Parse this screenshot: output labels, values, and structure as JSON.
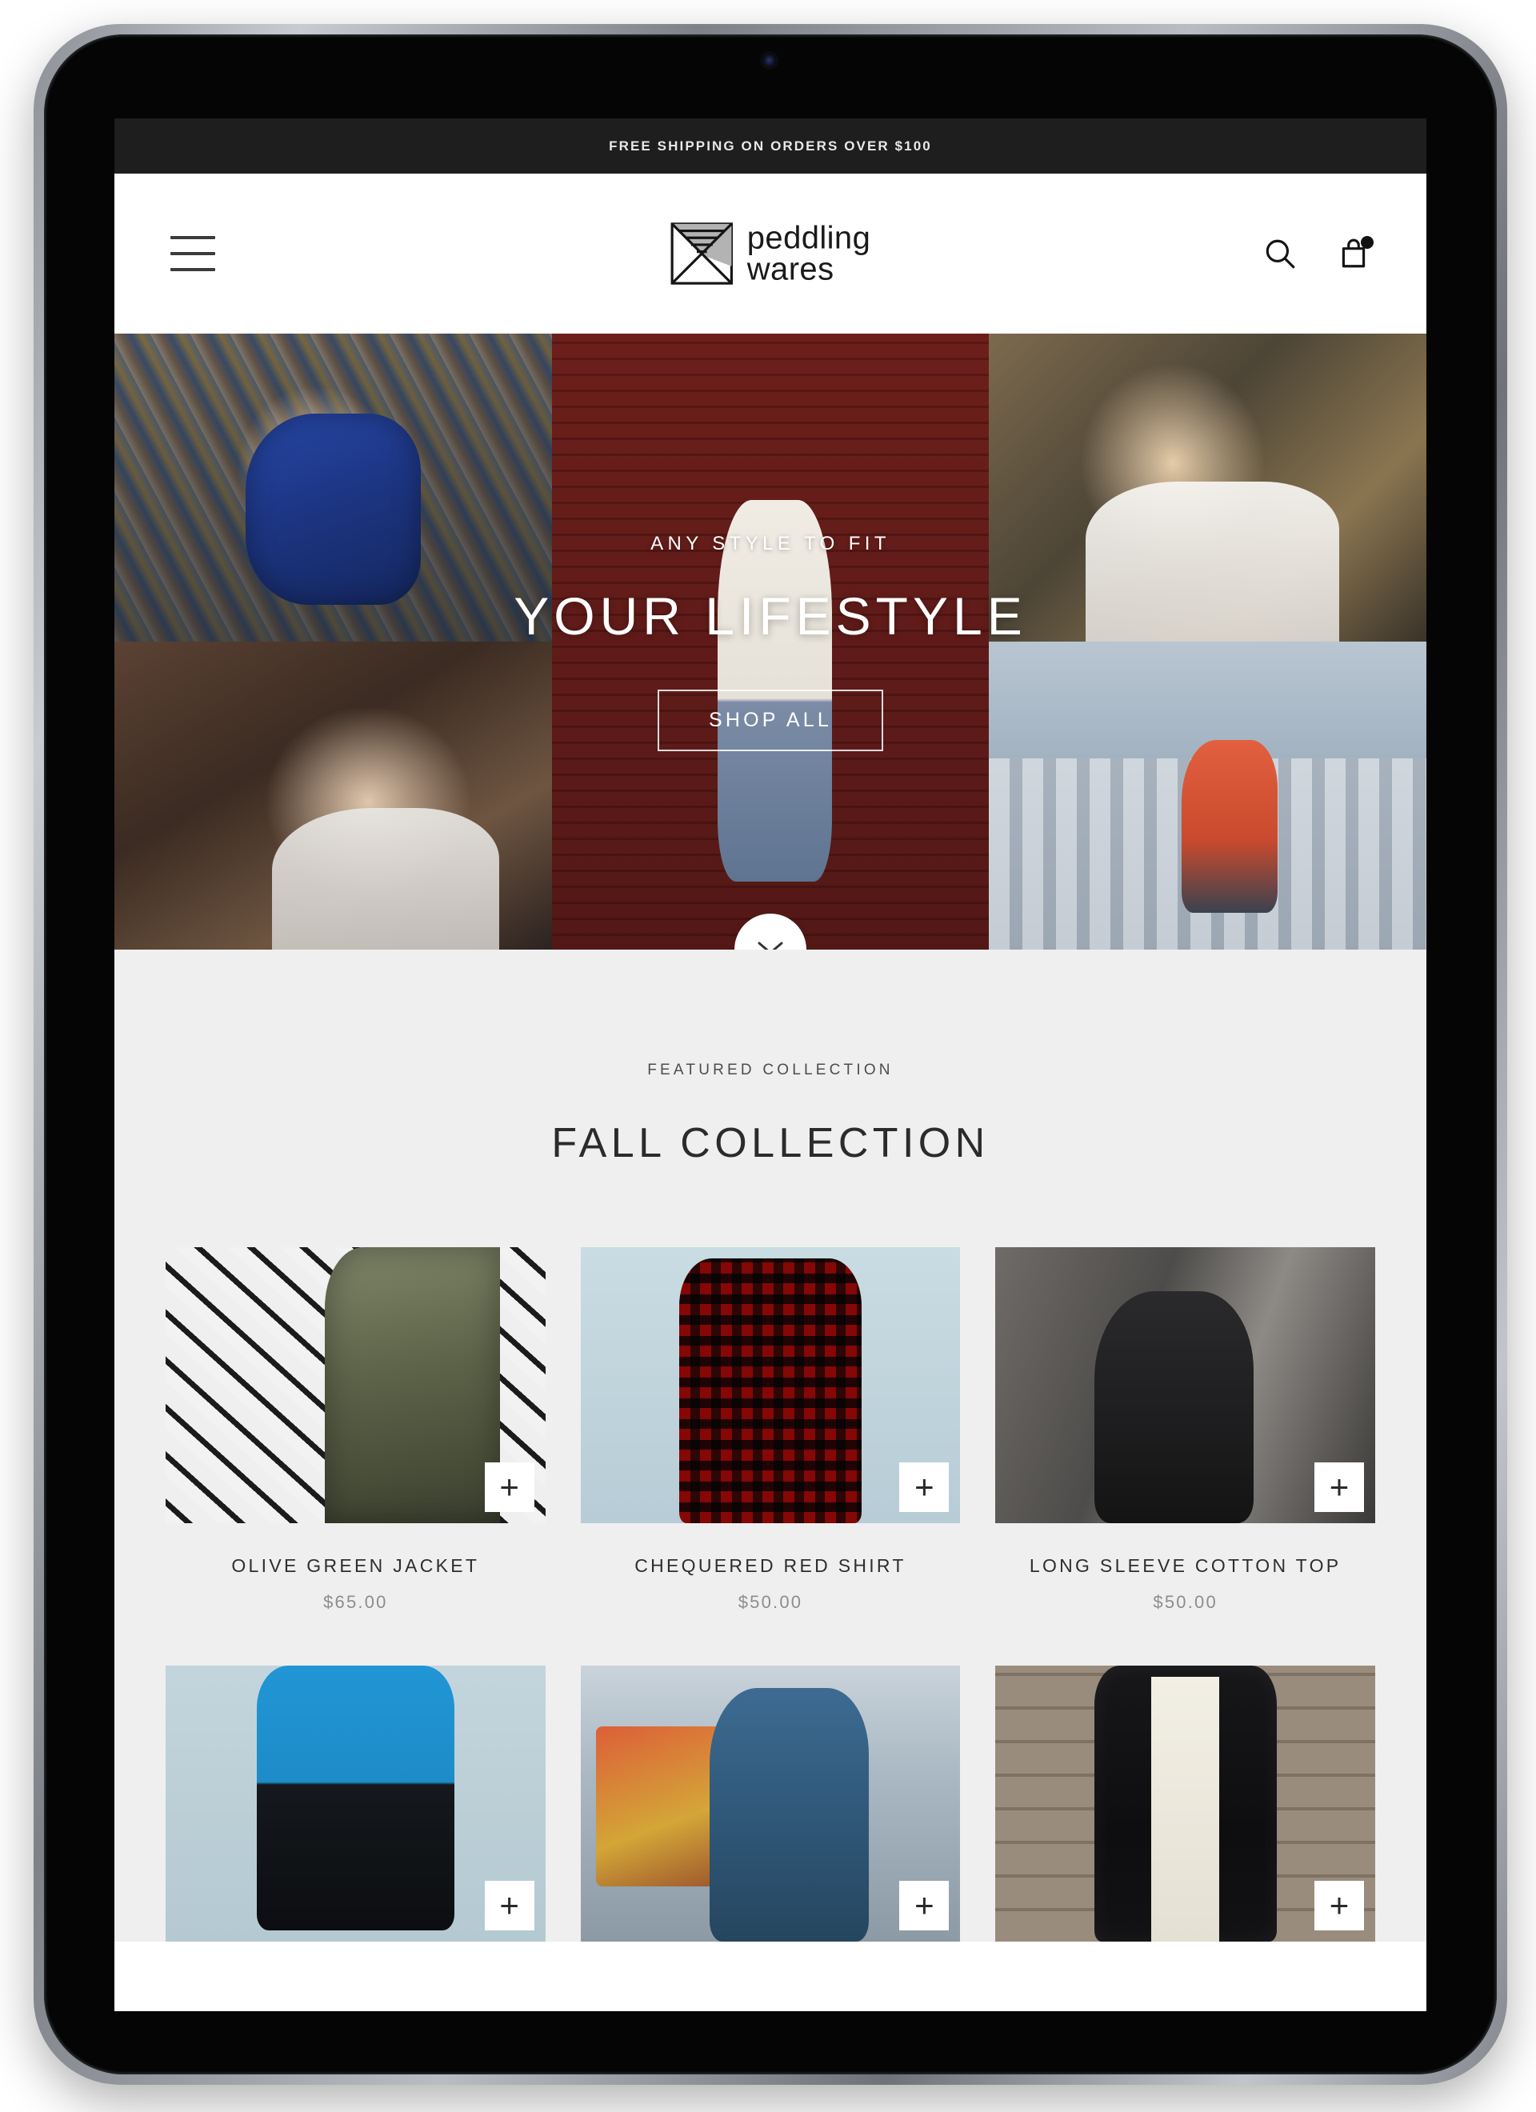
{
  "announcement": {
    "text": "FREE SHIPPING ON ORDERS OVER $100",
    "background": "#1e1e1e",
    "color": "#e8e8e8"
  },
  "header": {
    "menu_icon": "hamburger-menu-icon",
    "brand": {
      "mark_icon": "peddling-wares-logo-mark",
      "line1": "peddling",
      "line2": "wares"
    },
    "actions": [
      {
        "name": "search",
        "icon": "search-icon",
        "label": "Search"
      },
      {
        "name": "cart",
        "icon": "shopping-bag-icon",
        "label": "Cart",
        "badge": true
      }
    ]
  },
  "hero": {
    "eyebrow": "ANY STYLE TO FIT",
    "title": "YOUR LIFESTYLE",
    "cta_label": "SHOP ALL",
    "scroll_icon": "chevron-down-icon",
    "tiles": [
      {
        "name": "blonde-woman-at-fairground",
        "style": "ph-fair-blonde"
      },
      {
        "name": "couple-embracing-sunset",
        "style": "ph-couple-sunset"
      },
      {
        "name": "woman-against-red-brick-wall",
        "style": "ph-redbrick"
      },
      {
        "name": "blond-man-in-white-shirt",
        "style": "ph-blond-man"
      },
      {
        "name": "woman-on-swing-ride-city-skyline",
        "style": "ph-city-swing"
      }
    ]
  },
  "featured": {
    "eyebrow": "FEATURED COLLECTION",
    "title": "FALL COLLECTION",
    "background": "#efefef",
    "quickadd_label": "+",
    "products": [
      {
        "name": "OLIVE GREEN JACKET",
        "price": "$65.00",
        "image_name": "olive-green-jacket-graffiti-wall",
        "style": "ph-graffiti"
      },
      {
        "name": "CHEQUERED RED SHIRT",
        "price": "$50.00",
        "image_name": "chequered-red-shirt-blue-background",
        "style": "ph-redplaid"
      },
      {
        "name": "LONG SLEEVE COTTON TOP",
        "price": "$50.00",
        "image_name": "long-sleeve-cotton-top-woman-steps",
        "style": "ph-cottontop"
      },
      {
        "name": "",
        "price": "",
        "image_name": "blue-black-windbreaker-jacket",
        "style": "ph-windbreaker"
      },
      {
        "name": "",
        "price": "",
        "image_name": "denim-jacket-woman-at-fair",
        "style": "ph-denim-fair"
      },
      {
        "name": "",
        "price": "",
        "image_name": "black-leather-jacket-wooden-wall",
        "style": "ph-leather-wood"
      }
    ]
  }
}
